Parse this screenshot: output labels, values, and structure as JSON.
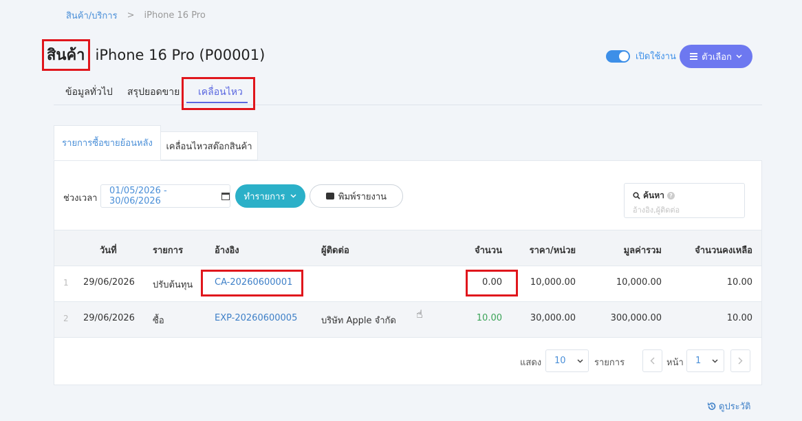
{
  "breadcrumb": {
    "parent": "สินค้า/บริการ",
    "separator": ">",
    "current": "iPhone 16 Pro"
  },
  "header": {
    "type_label": "สินค้า",
    "product_name": "iPhone 16 Pro (P00001)"
  },
  "toggle": {
    "label": "เปิดใช้งาน",
    "on": true
  },
  "options_button": {
    "icon": "menu-icon",
    "label": "ตัวเลือก"
  },
  "main_tabs": [
    {
      "label": "ข้อมูลทั่วไป",
      "active": false
    },
    {
      "label": "สรุปยอดขาย",
      "active": false
    },
    {
      "label": "เคลื่อนไหว",
      "active": true
    }
  ],
  "sub_tabs": [
    {
      "label": "รายการซื้อขายย้อนหลัง",
      "active": true
    },
    {
      "label": "เคลื่อนไหวสต๊อกสินค้า",
      "active": false
    }
  ],
  "filter": {
    "period_label": "ช่วงเวลา",
    "date_range": "01/05/2026 - 30/06/2026",
    "action_button": "ทำรายการ",
    "print_button": "พิมพ์รายงาน"
  },
  "search": {
    "label": "ค้นหา",
    "placeholder": "อ้างอิง,ผู้ติดต่อ"
  },
  "table": {
    "headers": [
      "วันที่",
      "รายการ",
      "อ้างอิง",
      "ผู้ติดต่อ",
      "จำนวน",
      "ราคา/หน่วย",
      "มูลค่ารวม",
      "จำนวนคงเหลือ"
    ],
    "rows": [
      {
        "no": "1",
        "date": "29/06/2026",
        "type": "ปรับต้นทุน",
        "ref": "CA-20260600001",
        "contact": "",
        "qty": "0.00",
        "unit_price": "10,000.00",
        "total": "10,000.00",
        "balance": "10.00"
      },
      {
        "no": "2",
        "date": "29/06/2026",
        "type": "ซื้อ",
        "ref": "EXP-20260600005",
        "contact": "บริษัท Apple จำกัด",
        "qty": "10.00",
        "unit_price": "30,000.00",
        "total": "300,000.00",
        "balance": "10.00"
      }
    ]
  },
  "pagination": {
    "show_label": "แสดง",
    "page_size": "10",
    "items_label": "รายการ",
    "page_label": "หน้า",
    "page": "1"
  },
  "history_link": "ดูประวัติ",
  "colors": {
    "accent": "#6d78f0",
    "teal": "#2bb0c8",
    "link": "#3d7fc7",
    "highlight_red": "#e0161c",
    "positive": "#3aa357"
  }
}
